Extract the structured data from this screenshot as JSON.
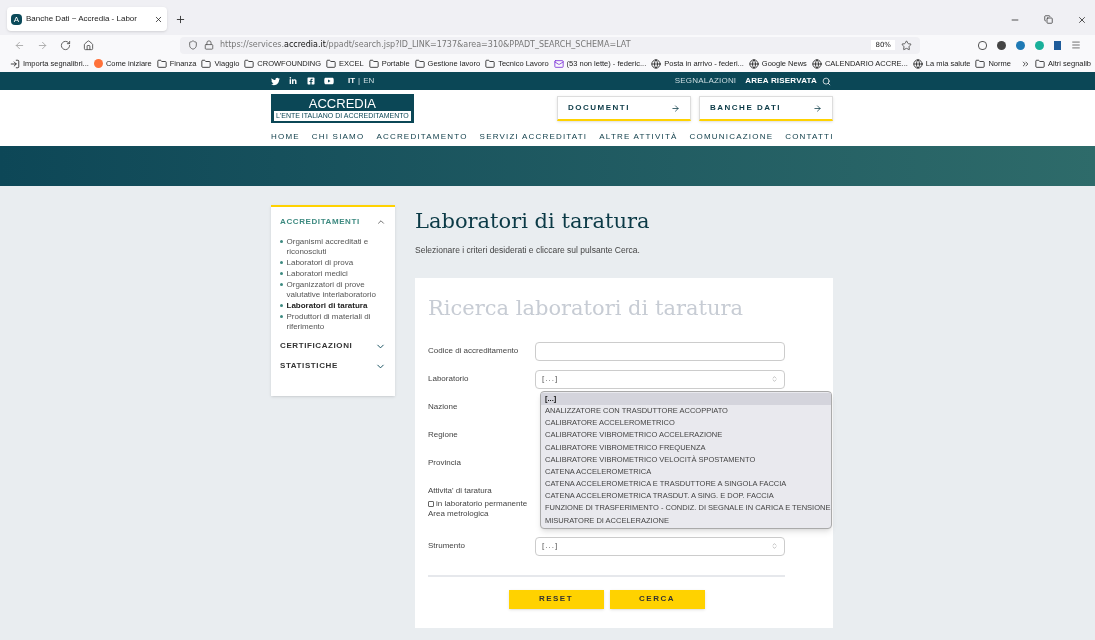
{
  "browser": {
    "tab_title": "Banche Dati ~ Accredia - Labor",
    "tab_icon": "A",
    "url_prefix": "https://services.",
    "url_domain": "accredia.it",
    "url_rest": "/ppadt/search.jsp?ID_LINK=1737&area=310&PPADT_SEARCH_SCHEMA=LAT",
    "zoom": "80%",
    "bookmarks": [
      {
        "kind": "import",
        "label": "Importa segnalibri..."
      },
      {
        "kind": "firefox",
        "label": "Come iniziare"
      },
      {
        "kind": "folder",
        "label": "Finanza"
      },
      {
        "kind": "folder",
        "label": "Viaggio"
      },
      {
        "kind": "folder",
        "label": "CROWFOUNDING"
      },
      {
        "kind": "folder",
        "label": "EXCEL"
      },
      {
        "kind": "folder",
        "label": "Portable"
      },
      {
        "kind": "folder",
        "label": "Gestione lavoro"
      },
      {
        "kind": "folder",
        "label": "Tecnico Lavoro"
      },
      {
        "kind": "mail",
        "label": "(53 non lette) - federic..."
      },
      {
        "kind": "globe",
        "label": "Posta in arrivo - federi..."
      },
      {
        "kind": "globe",
        "label": "Google News"
      },
      {
        "kind": "globe",
        "label": "CALENDARIO ACCRE..."
      },
      {
        "kind": "globe",
        "label": "La mia salute"
      },
      {
        "kind": "folder",
        "label": "Norme"
      }
    ],
    "other_bookmarks": "Altri segnalib"
  },
  "site": {
    "languages": [
      {
        "label": "IT",
        "selected": true
      },
      {
        "label": "EN",
        "selected": false
      }
    ],
    "language_separator": "|",
    "top_links": [
      "SEGNALAZIONI"
    ],
    "reserved_area": "AREA RISERVATA",
    "logo": {
      "name": "ACCREDIA",
      "tagline": "L'ENTE ITALIANO DI ACCREDITAMENTO"
    },
    "header_buttons": [
      "DOCUMENTI",
      "BANCHE DATI"
    ],
    "nav": [
      "HOME",
      "CHI SIAMO",
      "ACCREDITAMENTO",
      "SERVIZI ACCREDITATI",
      "ALTRE ATTIVITÀ",
      "COMUNICAZIONE",
      "CONTATTI"
    ]
  },
  "sidebar": [
    {
      "title": "ACCREDITAMENTI",
      "expanded": true,
      "items": [
        {
          "label": "Organismi accreditati e riconosciuti",
          "selected": false
        },
        {
          "label": "Laboratori di prova",
          "selected": false
        },
        {
          "label": "Laboratori medici",
          "selected": false
        },
        {
          "label": "Organizzatori di prove valutative interlaboratorio",
          "selected": false
        },
        {
          "label": "Laboratori di taratura",
          "selected": true
        },
        {
          "label": "Produttori di materiali di riferimento",
          "selected": false
        }
      ]
    },
    {
      "title": "CERTIFICAZIONI",
      "expanded": false
    },
    {
      "title": "STATISTICHE",
      "expanded": false
    }
  ],
  "page": {
    "title": "Laboratori di taratura",
    "subtitle": "Selezionare i criteri desiderati e cliccare sul pulsante Cerca."
  },
  "form": {
    "title": "Ricerca laboratori di taratura",
    "fields": [
      {
        "label": "Codice di accreditamento",
        "kind": "text"
      },
      {
        "label": "Laboratorio",
        "kind": "select",
        "value": "[...]"
      },
      {
        "label": "Nazione",
        "kind": "covered"
      },
      {
        "label": "Regione",
        "kind": "covered"
      },
      {
        "label": "Provincia",
        "kind": "covered"
      },
      {
        "label": "Attivita' di taratura",
        "kind": "checkbox",
        "option": "in laboratorio permanente",
        "checked": false
      },
      {
        "label": "Area metrologica",
        "kind": "covered"
      },
      {
        "label": "Strumento",
        "kind": "select",
        "value": "[...]"
      }
    ],
    "dropdown": [
      {
        "label": "[...]",
        "selected": true
      },
      {
        "label": "ANALIZZATORE CON TRASDUTTORE ACCOPPIATO",
        "selected": false
      },
      {
        "label": "CALIBRATORE ACCELEROMETRICO",
        "selected": false
      },
      {
        "label": "CALIBRATORE VIBROMETRICO ACCELERAZIONE",
        "selected": false
      },
      {
        "label": "CALIBRATORE VIBROMETRICO FREQUENZA",
        "selected": false
      },
      {
        "label": "CALIBRATORE VIBROMETRICO VELOCITÀ SPOSTAMENTO",
        "selected": false
      },
      {
        "label": "CATENA ACCELEROMETRICA",
        "selected": false
      },
      {
        "label": "CATENA ACCELEROMETRICA E TRASDUTTORE A SINGOLA FACCIA",
        "selected": false
      },
      {
        "label": "CATENA ACCELEROMETRICA TRASDUT. A SING. E DOP. FACCIA",
        "selected": false
      },
      {
        "label": "FUNZIONE DI TRASFERIMENTO - CONDIZ. DI SEGNALE IN CARICA E TENSIONE",
        "selected": false
      },
      {
        "label": "MISURATORE DI ACCELERAZIONE",
        "selected": false
      }
    ],
    "buttons": [
      "RESET",
      "CERCA"
    ]
  }
}
